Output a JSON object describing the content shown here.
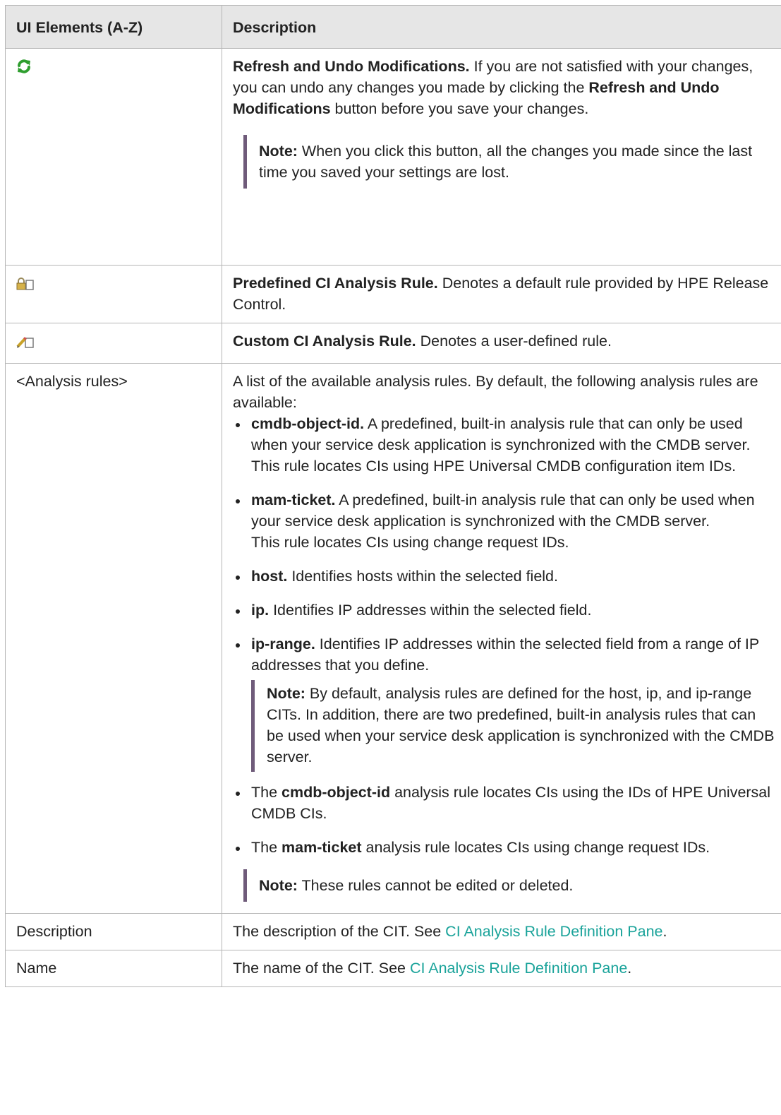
{
  "header": {
    "col1": "UI Elements (A-Z)",
    "col2": "Description"
  },
  "refresh": {
    "icon": "refresh-icon",
    "title": "Refresh and Undo Modifications.",
    "text1": " If you are not satisfied with your changes, you can undo any changes you made by clicking the ",
    "bold2": "Refresh and Undo Modifications",
    "text2": " button before you save your changes.",
    "note_label": "Note:",
    "note_text": " When you click this button, all the changes you made since the last time you saved your settings are lost."
  },
  "predefined": {
    "icon": "lock-icon",
    "title": "Predefined CI Analysis Rule.",
    "text": " Denotes a default rule provided by HPE Release Control."
  },
  "custom": {
    "icon": "pencil-icon",
    "title": "Custom CI Analysis Rule.",
    "text": " Denotes a user-defined rule."
  },
  "analysis": {
    "label": "<Analysis rules>",
    "intro": "A list of the available analysis rules. By default, the following analysis rules are available:",
    "items": [
      {
        "bold": "cmdb-object-id.",
        "text": " A predefined, built-in analysis rule that can only be used when your service desk application is synchronized with the CMDB server.",
        "extra": "This rule locates CIs using HPE Universal CMDB configuration item IDs."
      },
      {
        "bold": "mam-ticket.",
        "text": " A predefined, built-in analysis rule that can only be used when your service desk application is synchronized with the CMDB server.",
        "extra": "This rule locates CIs using change request IDs."
      },
      {
        "bold": "host.",
        "text": " Identifies hosts within the selected field."
      },
      {
        "bold": "ip.",
        "text": " Identifies IP addresses within the selected field."
      },
      {
        "bold": "ip-range.",
        "text": " Identifies IP addresses within the selected field from a range of IP addresses that you define."
      }
    ],
    "inner_note_label": "Note:",
    "inner_note_text": "  By default, analysis rules are defined for the host, ip, and ip-range CITs. In addition, there are two predefined, built-in analysis rules that can be used when your service desk application is synchronized with the CMDB server.",
    "items2": [
      {
        "pre": "The ",
        "bold": "cmdb-object-id",
        "text": " analysis rule locates CIs using the IDs of HPE Universal CMDB CIs."
      },
      {
        "pre": "The ",
        "bold": "mam-ticket",
        "text": " analysis rule locates CIs using change request IDs."
      }
    ],
    "note_label": "Note:",
    "note_text": "  These rules cannot be edited or deleted."
  },
  "description_row": {
    "label": "Description",
    "text": "The description of the CIT. See ",
    "link": "CI Analysis Rule Definition Pane",
    "end": "."
  },
  "name_row": {
    "label": "Name",
    "text": "The name of the CIT. See ",
    "link": "CI Analysis Rule Definition Pane",
    "end": "."
  },
  "colors": {
    "link": "#1aa39a",
    "note_bar": "#6f5b7a",
    "header_bg": "#e6e6e6"
  }
}
